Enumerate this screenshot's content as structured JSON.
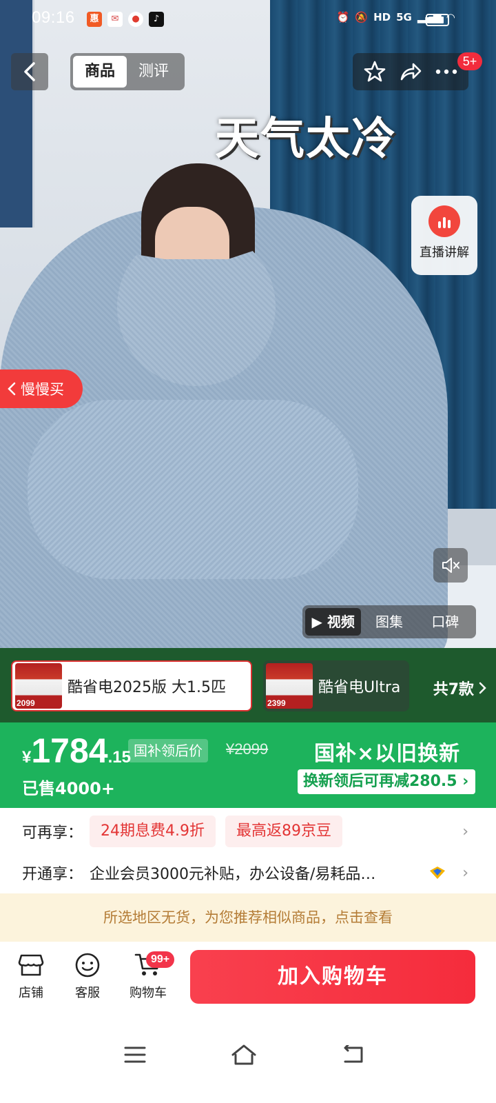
{
  "status_bar": {
    "time": "09:16",
    "notifications": [
      "app-notification-1",
      "app-notification-2",
      "app-notification-3",
      "tiktok-icon"
    ],
    "network": "5G",
    "hd": "HD"
  },
  "nav": {
    "tabs": [
      {
        "label": "商品",
        "active": true
      },
      {
        "label": "测评",
        "active": false
      }
    ],
    "more_badge": "5+"
  },
  "hero": {
    "caption": "天气太冷",
    "live_label": "直播讲解",
    "slow_buy": "慢慢买",
    "media_tabs": [
      {
        "label": "视频",
        "active": true
      },
      {
        "label": "图集",
        "active": false
      },
      {
        "label": "口碑",
        "active": false
      }
    ]
  },
  "variants": {
    "items": [
      {
        "title": "酷省电2025版 大1.5匹",
        "thumb_price": "2099",
        "selected": true
      },
      {
        "title": "酷省电Ultra",
        "thumb_price": "2399",
        "selected": false
      }
    ],
    "count_label": "共7款"
  },
  "price": {
    "currency": "¥",
    "integer": "1784",
    "decimal": ".15",
    "subsidy_tag": "国补领后价",
    "original": "¥2099",
    "sold": "已售4000+",
    "trade_in_title": "国补×以旧换新",
    "trade_in_sub": "换新领后可再减280.5"
  },
  "benefits": {
    "row1_label": "可再享：",
    "pills": [
      "24期息费4.9折",
      "最高返89京豆"
    ],
    "row2_label": "开通享：",
    "row2_text": "企业会员3000元补贴，办公设备/易耗品…"
  },
  "notice": "所选地区无货，为您推荐相似商品，点击查看",
  "bottom_bar": {
    "store": "店铺",
    "service": "客服",
    "cart": "购物车",
    "cart_badge": "99+",
    "add_to_cart": "加入购物车"
  },
  "colors": {
    "brand_red": "#f52c3c",
    "price_green": "#1db35c",
    "notice_bg": "#fcf3dc"
  }
}
